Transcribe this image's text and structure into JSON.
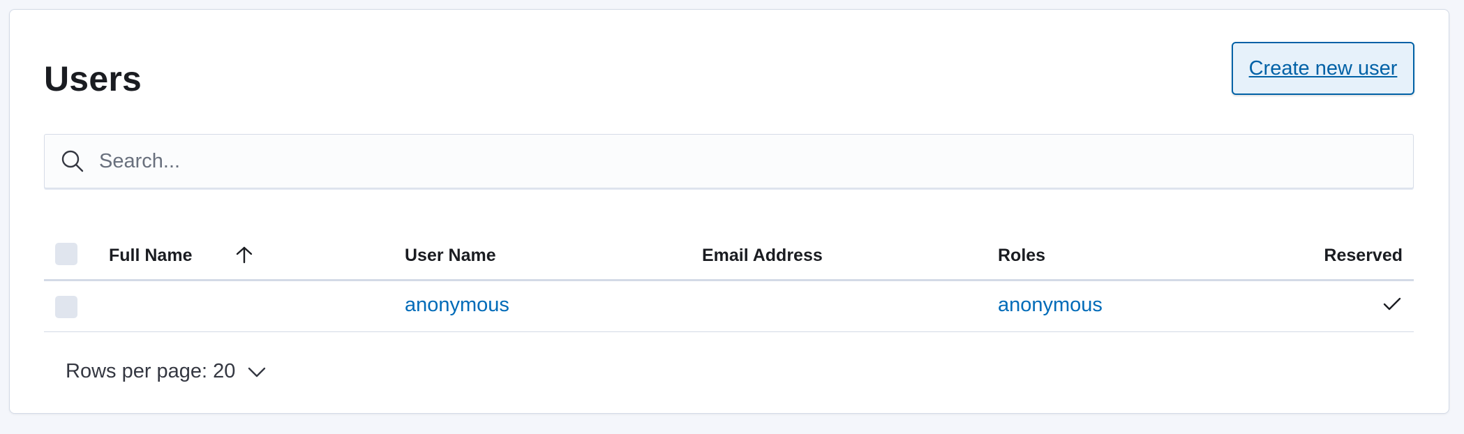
{
  "page": {
    "title": "Users",
    "create_button_label": "Create new user"
  },
  "search": {
    "placeholder": "Search...",
    "value": ""
  },
  "table": {
    "columns": [
      {
        "label": "Full Name",
        "sorted": "ascending"
      },
      {
        "label": "User Name"
      },
      {
        "label": "Email Address"
      },
      {
        "label": "Roles"
      },
      {
        "label": "Reserved"
      }
    ],
    "rows": [
      {
        "full_name": "",
        "user_name": "anonymous",
        "email": "",
        "roles": "anonymous",
        "reserved": true
      }
    ]
  },
  "pagination": {
    "rows_per_page_label": "Rows per page: 20"
  },
  "icons": {
    "search": "search-icon",
    "sort": "arrow-up-icon",
    "reserved": "checkmark-icon",
    "dropdown": "chevron-down-icon"
  },
  "colors": {
    "link": "#006bb8",
    "button_border": "#0061a6",
    "button_bg": "#e6f1fa",
    "background": "#f4f6fb"
  }
}
